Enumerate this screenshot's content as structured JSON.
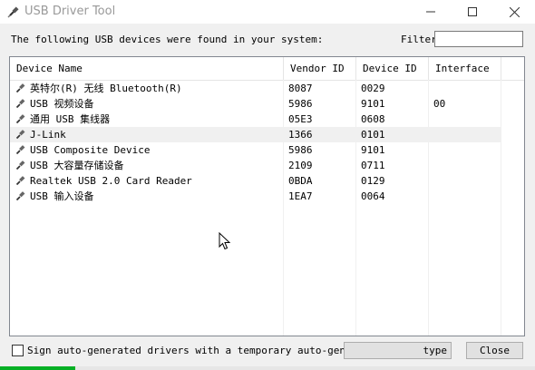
{
  "window": {
    "title": "USB Driver Tool",
    "app_icon": "usb-plug-icon",
    "controls": [
      "minimize-icon",
      "maximize-icon",
      "close-icon"
    ]
  },
  "prompt": "The following USB devices were found in your system:",
  "filter": {
    "label": "Filter",
    "value": "",
    "placeholder": ""
  },
  "device_list": {
    "columns": [
      "Device Name",
      "Vendor ID",
      "Device ID",
      "Interface"
    ],
    "rows": [
      {
        "name": "英特尔(R) 无线 Bluetooth(R)",
        "vendor": "8087",
        "device": "0029",
        "interface": ""
      },
      {
        "name": "USB 视频设备",
        "vendor": "5986",
        "device": "9101",
        "interface": "00"
      },
      {
        "name": "通用 USB 集线器",
        "vendor": "05E3",
        "device": "0608",
        "interface": ""
      },
      {
        "name": "J-Link",
        "vendor": "1366",
        "device": "0101",
        "interface": ""
      },
      {
        "name": "USB Composite Device",
        "vendor": "5986",
        "device": "9101",
        "interface": ""
      },
      {
        "name": "USB 大容量存储设备",
        "vendor": "2109",
        "device": "0711",
        "interface": ""
      },
      {
        "name": "Realtek USB 2.0 Card Reader",
        "vendor": "0BDA",
        "device": "0129",
        "interface": ""
      },
      {
        "name": "USB 输入设备",
        "vendor": "1EA7",
        "device": "0064",
        "interface": ""
      }
    ],
    "hovered_row": 3,
    "row_icon": "usb-plug-icon"
  },
  "sign_option": {
    "label": "Sign auto-generated drivers with a temporary auto-generated certificate",
    "checked": false
  },
  "buttons": {
    "install_label": "type",
    "close_label": "Close"
  },
  "progress": {
    "value_fraction": 0.14,
    "color": "#06b025"
  },
  "colors": {
    "title_text": "#999999",
    "window_bg": "#f0f0f0",
    "list_bg": "#ffffff",
    "hover_row": "#f0f0f0"
  }
}
